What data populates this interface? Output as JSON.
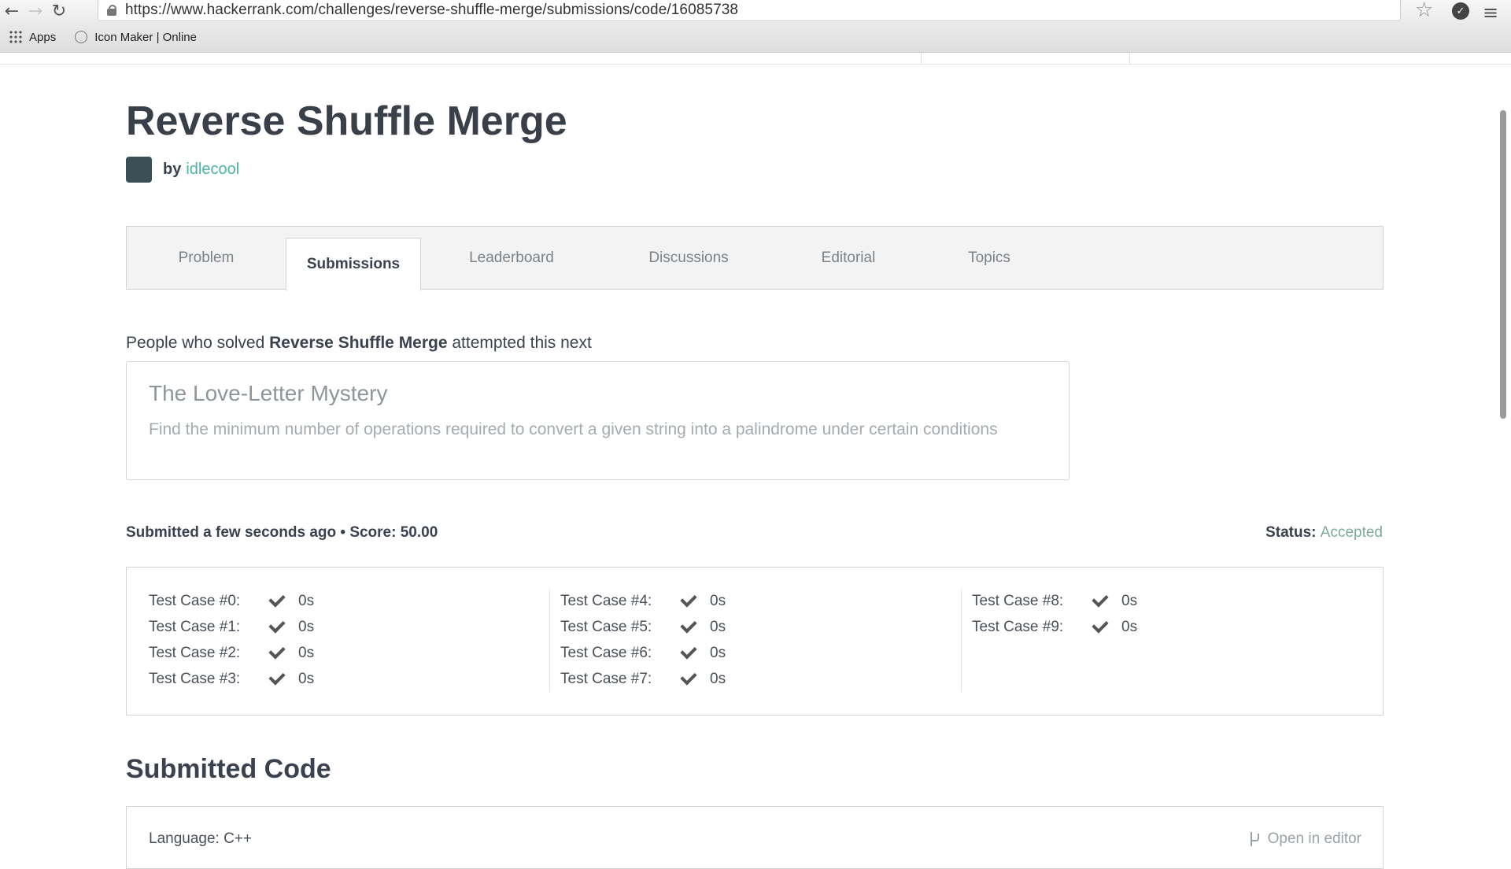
{
  "browser": {
    "url": "https://www.hackerrank.com/challenges/reverse-shuffle-merge/submissions/code/16085738",
    "bookmarks": [
      {
        "label": "Apps",
        "icon": "apps-grid-icon"
      },
      {
        "label": "Icon Maker | Online",
        "icon": "globe-icon"
      }
    ]
  },
  "challenge": {
    "title": "Reverse Shuffle Merge",
    "by_label": "by",
    "author": "idlecool"
  },
  "tabs": [
    {
      "label": "Problem",
      "active": false
    },
    {
      "label": "Submissions",
      "active": true
    },
    {
      "label": "Leaderboard",
      "active": false
    },
    {
      "label": "Discussions",
      "active": false
    },
    {
      "label": "Editorial",
      "active": false
    },
    {
      "label": "Topics",
      "active": false
    }
  ],
  "next": {
    "prefix": "People who solved ",
    "challenge_name": "Reverse Shuffle Merge",
    "suffix": " attempted this next",
    "card_title": "The Love-Letter Mystery",
    "card_description": "Find the minimum number of operations required to convert a given string into a palindrome under certain conditions"
  },
  "submission": {
    "info": "Submitted a few seconds ago • Score: 50.00",
    "status_label": "Status:",
    "status_value": "Accepted",
    "status_color": "#7ea99c"
  },
  "test_cases": [
    {
      "label": "Test Case #0:",
      "time": "0s",
      "passed": true
    },
    {
      "label": "Test Case #1:",
      "time": "0s",
      "passed": true
    },
    {
      "label": "Test Case #2:",
      "time": "0s",
      "passed": true
    },
    {
      "label": "Test Case #3:",
      "time": "0s",
      "passed": true
    },
    {
      "label": "Test Case #4:",
      "time": "0s",
      "passed": true
    },
    {
      "label": "Test Case #5:",
      "time": "0s",
      "passed": true
    },
    {
      "label": "Test Case #6:",
      "time": "0s",
      "passed": true
    },
    {
      "label": "Test Case #7:",
      "time": "0s",
      "passed": true
    },
    {
      "label": "Test Case #8:",
      "time": "0s",
      "passed": true
    },
    {
      "label": "Test Case #9:",
      "time": "0s",
      "passed": true
    }
  ],
  "code": {
    "heading": "Submitted Code",
    "language": "Language: C++",
    "open_editor": "Open in editor"
  },
  "colors": {
    "accent": "#4cb4a4",
    "text": "#39424e"
  }
}
